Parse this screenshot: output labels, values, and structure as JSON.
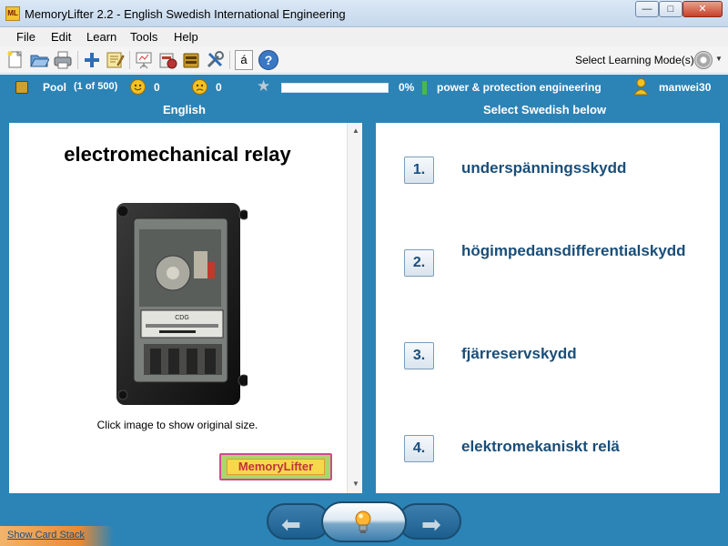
{
  "window": {
    "title": "MemoryLifter 2.2 - English Swedish International Engineering",
    "app_icon_text": "ML",
    "min_glyph": "—",
    "max_glyph": "□",
    "close_glyph": "✕"
  },
  "menu": [
    {
      "label": "File"
    },
    {
      "label": "Edit"
    },
    {
      "label": "Learn"
    },
    {
      "label": "Tools"
    },
    {
      "label": "Help"
    }
  ],
  "toolbar": {
    "buttons": [
      {
        "icon": "new-file-icon"
      },
      {
        "icon": "open-folder-icon"
      },
      {
        "icon": "print-icon"
      },
      {
        "icon": "add-card-icon"
      },
      {
        "icon": "edit-card-icon"
      },
      {
        "icon": "presentation-icon"
      },
      {
        "icon": "statistics-icon"
      },
      {
        "icon": "card-box-icon"
      },
      {
        "icon": "settings-tools-icon"
      },
      {
        "icon": "special-character-icon"
      },
      {
        "icon": "help-icon"
      }
    ],
    "special_char_glyph": "á",
    "help_glyph": "?",
    "learning_mode_label": "Select Learning Mode(s)",
    "caret": "▼"
  },
  "status": {
    "pool_label": "Pool",
    "pool_count": "(1 of 500)",
    "correct_count": "0",
    "wrong_count": "0",
    "star_glyph": "★",
    "progress_fraction": 0.0,
    "progress_text": "0%",
    "chapter": "power & protection engineering",
    "user": "manwei30"
  },
  "question": {
    "header": "English",
    "word": "electromechanical relay",
    "image_hint": "Click image to show original size.",
    "image_label": "CDG",
    "logo_text": "MemoryLifter",
    "scroll_up": "▲",
    "scroll_down": "▼"
  },
  "answers": {
    "header": "Select Swedish below",
    "items": [
      {
        "key": "1.",
        "text": "underspänningsskydd"
      },
      {
        "key": "2.",
        "text": "högimpedansdifferentialskydd"
      },
      {
        "key": "3.",
        "text": "fjärreservskydd"
      },
      {
        "key": "4.",
        "text": "elektromekaniskt relä"
      }
    ]
  },
  "nav": {
    "prev_glyph": "⬅",
    "next_glyph": "➡"
  },
  "footer": {
    "card_stack_link": "Show Card Stack"
  }
}
